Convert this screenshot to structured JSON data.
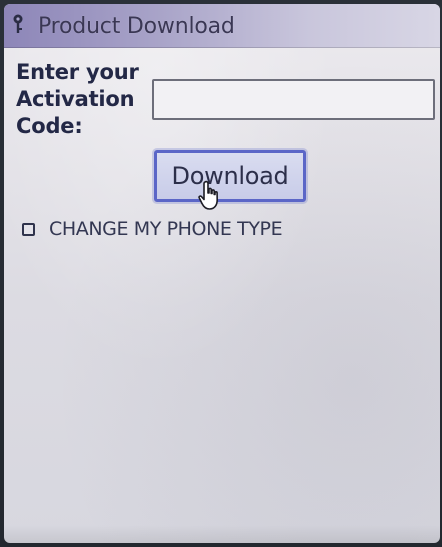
{
  "window": {
    "title": "Product Download",
    "icon": "key-icon"
  },
  "form": {
    "label": "Enter your\nActivation\nCode:",
    "activation_code_value": "",
    "download_label": "Download",
    "checkbox_label": "CHANGE MY PHONE TYPE",
    "checkbox_checked": false
  },
  "colors": {
    "titlebar_start": "#8d86b8",
    "titlebar_end": "#d8d6e5",
    "button_border": "#5b66c7",
    "label_text": "#232846"
  }
}
